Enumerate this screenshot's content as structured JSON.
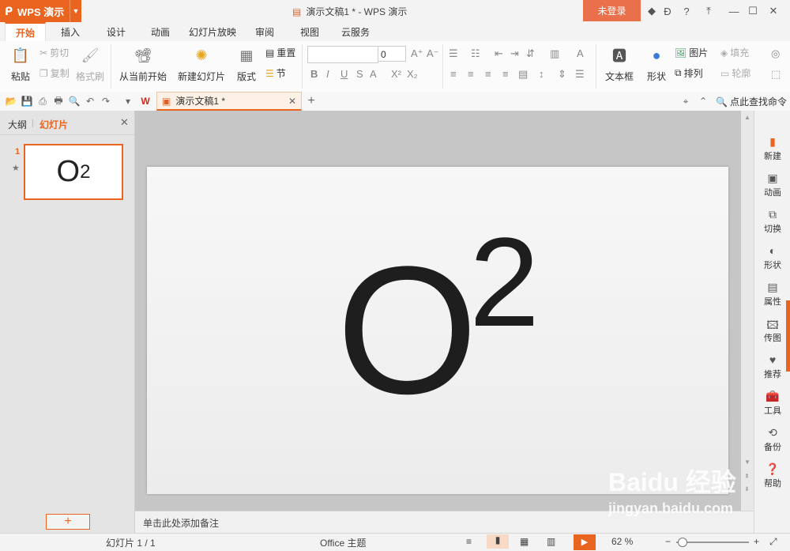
{
  "titlebar": {
    "app_menu": "WPS 演示",
    "doc_title": "演示文稿1 * - WPS 演示",
    "login": "未登录"
  },
  "tabs": [
    "开始",
    "插入",
    "设计",
    "动画",
    "幻灯片放映",
    "审阅",
    "视图",
    "云服务"
  ],
  "ribbon": {
    "paste": "粘贴",
    "cut": "剪切",
    "copy": "复制",
    "format_painter": "格式刷",
    "from_current": "从当前开始",
    "new_slide": "新建幻灯片",
    "layout": "版式",
    "reset": "重置",
    "section": "节",
    "font_size": "0",
    "textbox": "文本框",
    "shape": "形状",
    "picture": "图片",
    "fill": "填充",
    "arrange": "排列",
    "outline": "轮廓"
  },
  "quickbar": {
    "doc_tab": "演示文稿1 *",
    "search": "点此查找命令"
  },
  "left_panel": {
    "tab_outline": "大纲",
    "tab_slides": "幻灯片",
    "slide_number": "1",
    "add_button": "+"
  },
  "slide": {
    "base": "O",
    "superscript": "2"
  },
  "notes_placeholder": "单击此处添加备注",
  "right_sidebar": [
    {
      "label": "新建",
      "icon": "new-doc-icon"
    },
    {
      "label": "动画",
      "icon": "animation-icon"
    },
    {
      "label": "切换",
      "icon": "transition-icon"
    },
    {
      "label": "形状",
      "icon": "shapes-icon"
    },
    {
      "label": "属性",
      "icon": "properties-icon"
    },
    {
      "label": "传图",
      "icon": "upload-image-icon"
    },
    {
      "label": "推荐",
      "icon": "recommend-icon"
    },
    {
      "label": "工具",
      "icon": "toolbox-icon"
    },
    {
      "label": "备份",
      "icon": "backup-icon"
    },
    {
      "label": "帮助",
      "icon": "help-icon"
    }
  ],
  "statusbar": {
    "slide_info": "幻灯片 1 / 1",
    "theme": "Office 主题",
    "zoom": "62 %"
  },
  "watermark": {
    "brand": "Baidu 经验",
    "url": "jingyan.baidu.com"
  },
  "colors": {
    "accent": "#e9651f",
    "login": "#e9704a"
  }
}
